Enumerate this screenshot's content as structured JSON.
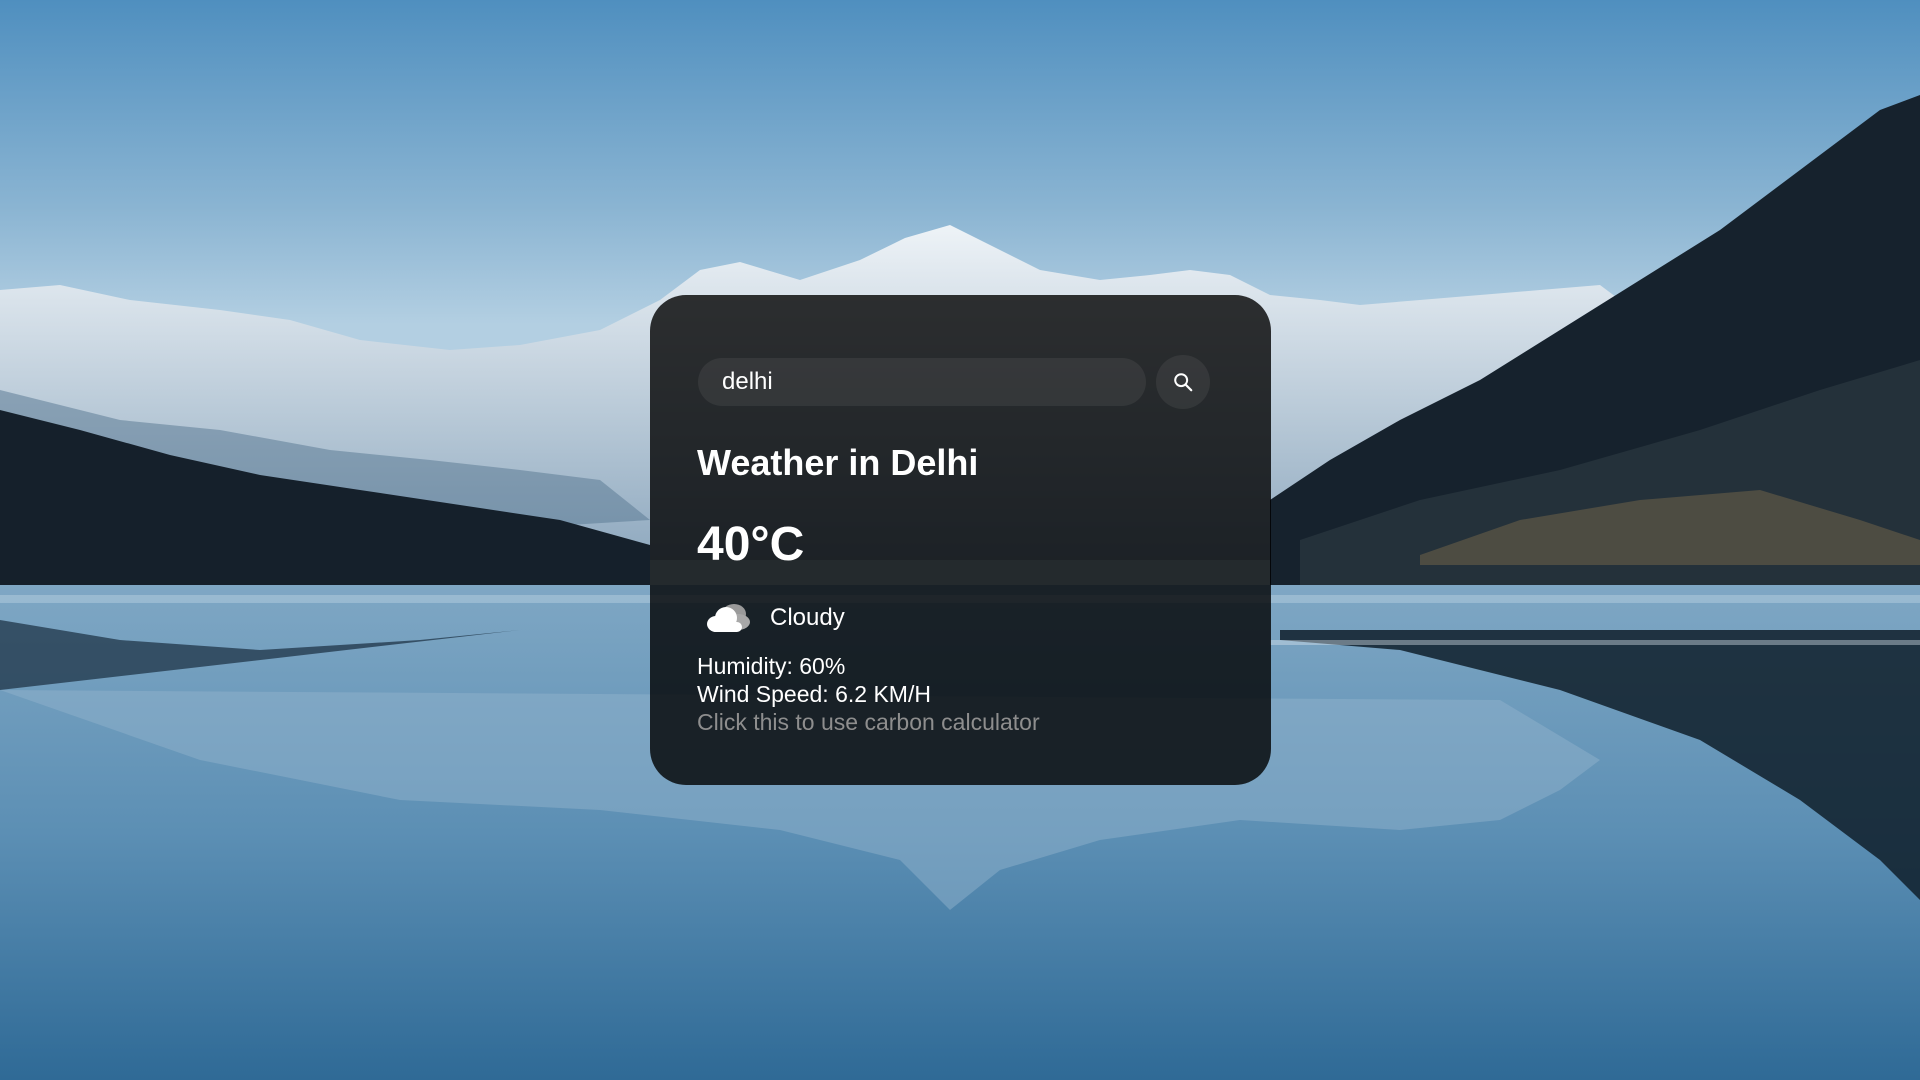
{
  "search": {
    "value": "delhi"
  },
  "weather": {
    "title": "Weather in Delhi",
    "temperature": "40°C",
    "condition": "Cloudy",
    "condition_icon": "cloud-icon",
    "humidity": "Humidity: 60%",
    "wind_speed": "Wind Speed: 6.2 KM/H"
  },
  "links": {
    "carbon_calculator": "Click this to use carbon calculator"
  },
  "icons": {
    "search": "search-icon"
  },
  "colors": {
    "card_background": "#000000cc",
    "text": "#ffffff",
    "link_text": "#8e8e8e",
    "sky_top": "#4f8fbf",
    "sky_bottom": "#a9cbe0"
  }
}
